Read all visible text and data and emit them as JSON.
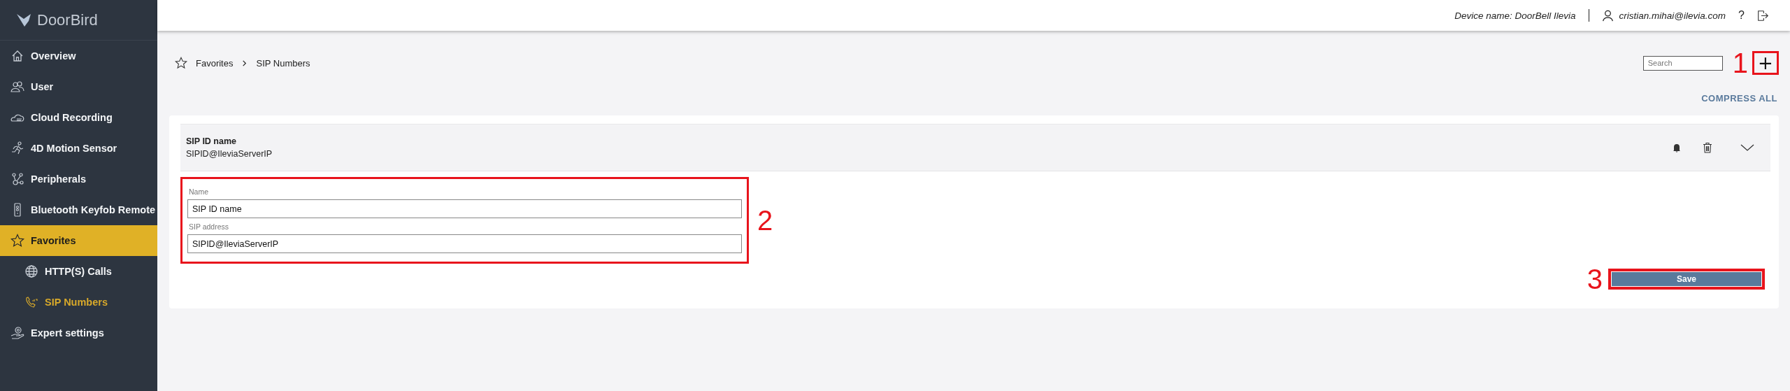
{
  "logo": {
    "text": "DoorBird"
  },
  "sidebar": {
    "items": [
      {
        "label": "Overview",
        "selected": false
      },
      {
        "label": "User",
        "selected": false
      },
      {
        "label": "Cloud Recording",
        "selected": false
      },
      {
        "label": "4D Motion Sensor",
        "selected": false
      },
      {
        "label": "Peripherals",
        "selected": false
      },
      {
        "label": "Bluetooth Keyfob Remote",
        "selected": false
      },
      {
        "label": "Favorites",
        "selected": true,
        "children": [
          {
            "label": "HTTP(S) Calls",
            "selected": false
          },
          {
            "label": "SIP Numbers",
            "selected": true
          }
        ]
      },
      {
        "label": "Expert settings",
        "selected": false
      }
    ]
  },
  "header": {
    "device_name": "Device name: DoorBell Ilevia",
    "user": "cristian.mihai@ilevia.com",
    "help": "?"
  },
  "breadcrumb": [
    "Favorites",
    "SIP Numbers"
  ],
  "search": {
    "placeholder": "Search"
  },
  "add_button": "+",
  "compress_all": "COMPRESS ALL",
  "entry": {
    "title": "SIP ID name",
    "subtitle": "SIPID@IleviaServerIP",
    "expanded": true,
    "fields": [
      {
        "label": "Name",
        "value": "SIP ID name"
      },
      {
        "label": "SIP address",
        "value": "SIPID@IleviaServerIP"
      }
    ],
    "save": "Save"
  },
  "annotations": [
    {
      "label": "1"
    },
    {
      "label": "2"
    },
    {
      "label": "3"
    }
  ]
}
